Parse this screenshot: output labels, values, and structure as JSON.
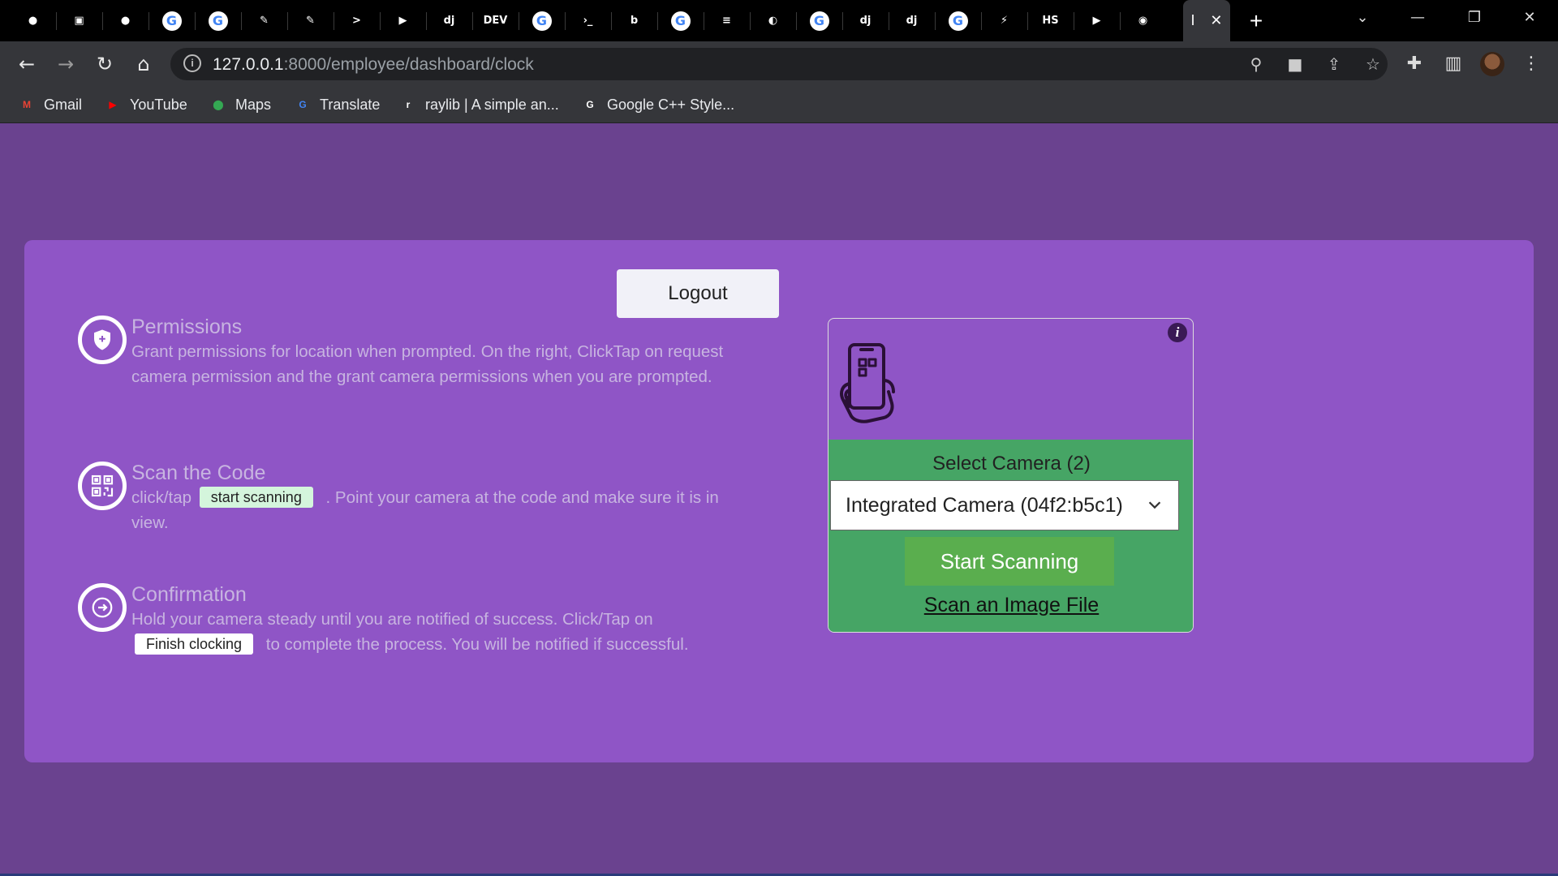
{
  "browser": {
    "active_tab_title": "I",
    "url_host": "127.0.0.1",
    "url_path": ":8000/employee/dashboard/clock",
    "tabs": [
      {
        "icon": "github-icon",
        "glyph": "●"
      },
      {
        "icon": "dashboard-icon",
        "glyph": "▣"
      },
      {
        "icon": "circle-icon",
        "glyph": "●"
      },
      {
        "icon": "google-icon",
        "glyph": "G"
      },
      {
        "icon": "google-icon",
        "glyph": "G"
      },
      {
        "icon": "feather-icon",
        "glyph": "✎"
      },
      {
        "icon": "feather-icon",
        "glyph": "✎"
      },
      {
        "icon": "terminal-icon",
        "glyph": ">"
      },
      {
        "icon": "play-icon",
        "glyph": "▶"
      },
      {
        "icon": "django-icon",
        "glyph": "dj"
      },
      {
        "icon": "dev-icon",
        "glyph": "DEV"
      },
      {
        "icon": "google-icon",
        "glyph": "G"
      },
      {
        "icon": "terminal-icon",
        "glyph": "›_"
      },
      {
        "icon": "bolt-icon",
        "glyph": "b"
      },
      {
        "icon": "google-icon",
        "glyph": "G"
      },
      {
        "icon": "stackoverflow-icon",
        "glyph": "≡"
      },
      {
        "icon": "globe-icon",
        "glyph": "◐"
      },
      {
        "icon": "google-icon",
        "glyph": "G"
      },
      {
        "icon": "django-icon",
        "glyph": "dj"
      },
      {
        "icon": "django-icon",
        "glyph": "dj"
      },
      {
        "icon": "google-icon",
        "glyph": "G"
      },
      {
        "icon": "lightning-icon",
        "glyph": "⚡"
      },
      {
        "icon": "hs-icon",
        "glyph": "HS"
      },
      {
        "icon": "youtube-icon",
        "glyph": "▶"
      },
      {
        "icon": "chrome-icon",
        "glyph": "◉"
      }
    ],
    "bookmarks": [
      {
        "label": "Gmail",
        "icon": "gmail-icon",
        "glyph": "M",
        "color": "#ea4335"
      },
      {
        "label": "YouTube",
        "icon": "youtube-icon",
        "glyph": "▶",
        "color": "#ff0000"
      },
      {
        "label": "Maps",
        "icon": "maps-icon",
        "glyph": "⬤",
        "color": "#34a853"
      },
      {
        "label": "Translate",
        "icon": "translate-icon",
        "glyph": "G",
        "color": "#4285f4"
      },
      {
        "label": "raylib | A simple an...",
        "icon": "raylib-icon",
        "glyph": "r",
        "color": "#ffffff"
      },
      {
        "label": "Google C++ Style...",
        "icon": "google-icon",
        "glyph": "G",
        "color": "#ffffff"
      }
    ]
  },
  "page": {
    "logout_label": "Logout",
    "steps": [
      {
        "icon": "shield-icon",
        "title": "Permissions",
        "body": "Grant permissions for location when prompted. On the right, ClickTap on request camera permission and the grant camera permissions when you are prompted."
      },
      {
        "icon": "qr-code-icon",
        "title": "Scan the Code",
        "body_before": "click/tap",
        "pill": "start scanning",
        "body_after": ". Point your camera at the code and make sure it is in view."
      },
      {
        "icon": "arrow-right-icon",
        "title": "Confirmation",
        "body_before": "Hold your camera steady until you are notified of success. Click/Tap on",
        "pill": "Finish clocking",
        "body_after": "to complete the process. You will be notified if successful."
      }
    ],
    "scanner": {
      "info_icon": "info-icon",
      "select_camera_label": "Select Camera (2)",
      "selected_camera": "Integrated Camera (04f2:b5c1)",
      "start_button": "Start Scanning",
      "scan_file_link": "Scan an Image File"
    }
  },
  "colors": {
    "page_background": "#6a428f",
    "card_background": "#8f55c6",
    "scanner_green": "#46a565",
    "start_button": "#5aae4e"
  }
}
